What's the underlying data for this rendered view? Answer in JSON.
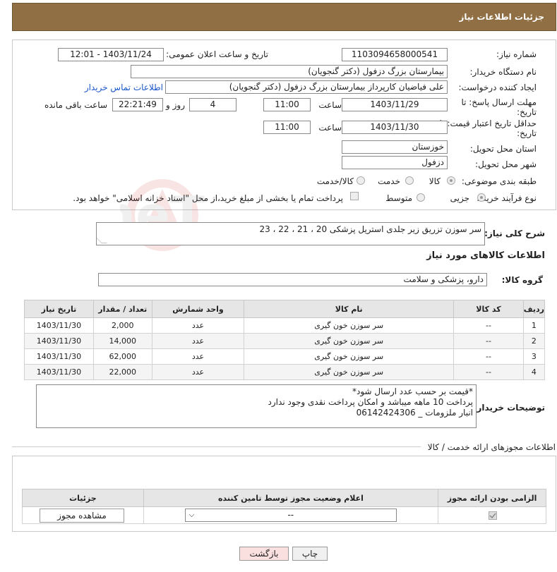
{
  "header": {
    "title": "جزئیات اطلاعات نیاز"
  },
  "form": {
    "need_number_label": "شماره نیاز:",
    "need_number": "1103094658000541",
    "announce_label": "تاریخ و ساعت اعلان عمومی:",
    "announce_value": "1403/11/24 - 12:01",
    "buyer_org_label": "نام دستگاه خریدار:",
    "buyer_org": "بیمارستان بزرگ دزفول (دکتر گنجویان)",
    "requester_label": "ایجاد کننده درخواست:",
    "requester": "علی فیاضیان کارپرداز بیمارستان بزرگ دزفول (دکتر گنجویان)",
    "contact_link": "اطلاعات تماس خریدار",
    "deadline_label_1": "مهلت ارسال پاسخ: تا",
    "deadline_label_2": "تاریخ:",
    "deadline_date": "1403/11/29",
    "time_label": "ساعت",
    "deadline_time": "11:00",
    "days_value": "4",
    "days_label": "روز و",
    "remaining_time": "22:21:49",
    "remaining_label": "ساعت باقی مانده",
    "validity_label_1": "حداقل تاریخ اعتبار قیمت: تا",
    "validity_label_2": "تاریخ:",
    "validity_date": "1403/11/30",
    "validity_time": "11:00",
    "province_label": "استان محل تحویل:",
    "province": "خوزستان",
    "city_label": "شهر محل تحویل:",
    "city": "دزفول",
    "category_label": "طبقه بندی موضوعی:",
    "category_options": [
      "کالا",
      "خدمت",
      "کالا/خدمت"
    ],
    "category_selected": "کالا",
    "process_label": "نوع فرآیند خرید :",
    "process_options": [
      "جزیی",
      "متوسط"
    ],
    "process_selected": "جزیی",
    "process_note": "پرداخت تمام یا بخشی از مبلغ خرید،از محل \"اسناد خزانه اسلامی\" خواهد بود."
  },
  "description": {
    "label": "شرح کلی نیاز:",
    "text": "سر سوزن تزریق زیر جلدی استریل پزشکی 20 ، 21 ، 22 ، 23"
  },
  "goods_section": {
    "title": "اطلاعات کالاهای مورد نیاز",
    "group_label": "گروه کالا:",
    "group_value": "دارو، پزشکی و سلامت"
  },
  "goods_table": {
    "headers": [
      "ردیف",
      "کد کالا",
      "نام کالا",
      "واحد شمارش",
      "تعداد / مقدار",
      "تاریخ نیاز"
    ],
    "rows": [
      {
        "row": "1",
        "code": "--",
        "name": "سر سوزن خون گیری",
        "unit": "عدد",
        "qty": "2,000",
        "date": "1403/11/30"
      },
      {
        "row": "2",
        "code": "--",
        "name": "سر سوزن خون گیری",
        "unit": "عدد",
        "qty": "14,000",
        "date": "1403/11/30"
      },
      {
        "row": "3",
        "code": "--",
        "name": "سر سوزن خون گیری",
        "unit": "عدد",
        "qty": "62,000",
        "date": "1403/11/30"
      },
      {
        "row": "4",
        "code": "--",
        "name": "سر سوزن خون گیری",
        "unit": "عدد",
        "qty": "22,000",
        "date": "1403/11/30"
      }
    ]
  },
  "buyer_notes": {
    "label": "توضیحات خریدار:",
    "lines": [
      "*قیمت بر حسب عدد ارسال شود*",
      "پرداخت 10 ماهه میباشد و امکان پرداخت نقدی وجود ندارد",
      "انبار ملزومات _ 06142424306"
    ]
  },
  "permits": {
    "title": "اطلاعات مجوزهای ارائه خدمت / کالا",
    "headers": [
      "الزامی بودن ارائه مجوز",
      "اعلام وضعیت مجوز توسط تامین کننده",
      "جزئیات"
    ],
    "select_value": "--",
    "view_button": "مشاهده مجوز"
  },
  "footer": {
    "print_button": "چاپ",
    "back_button": "بازگشت"
  },
  "watermark_text": "AriaTender.neT"
}
